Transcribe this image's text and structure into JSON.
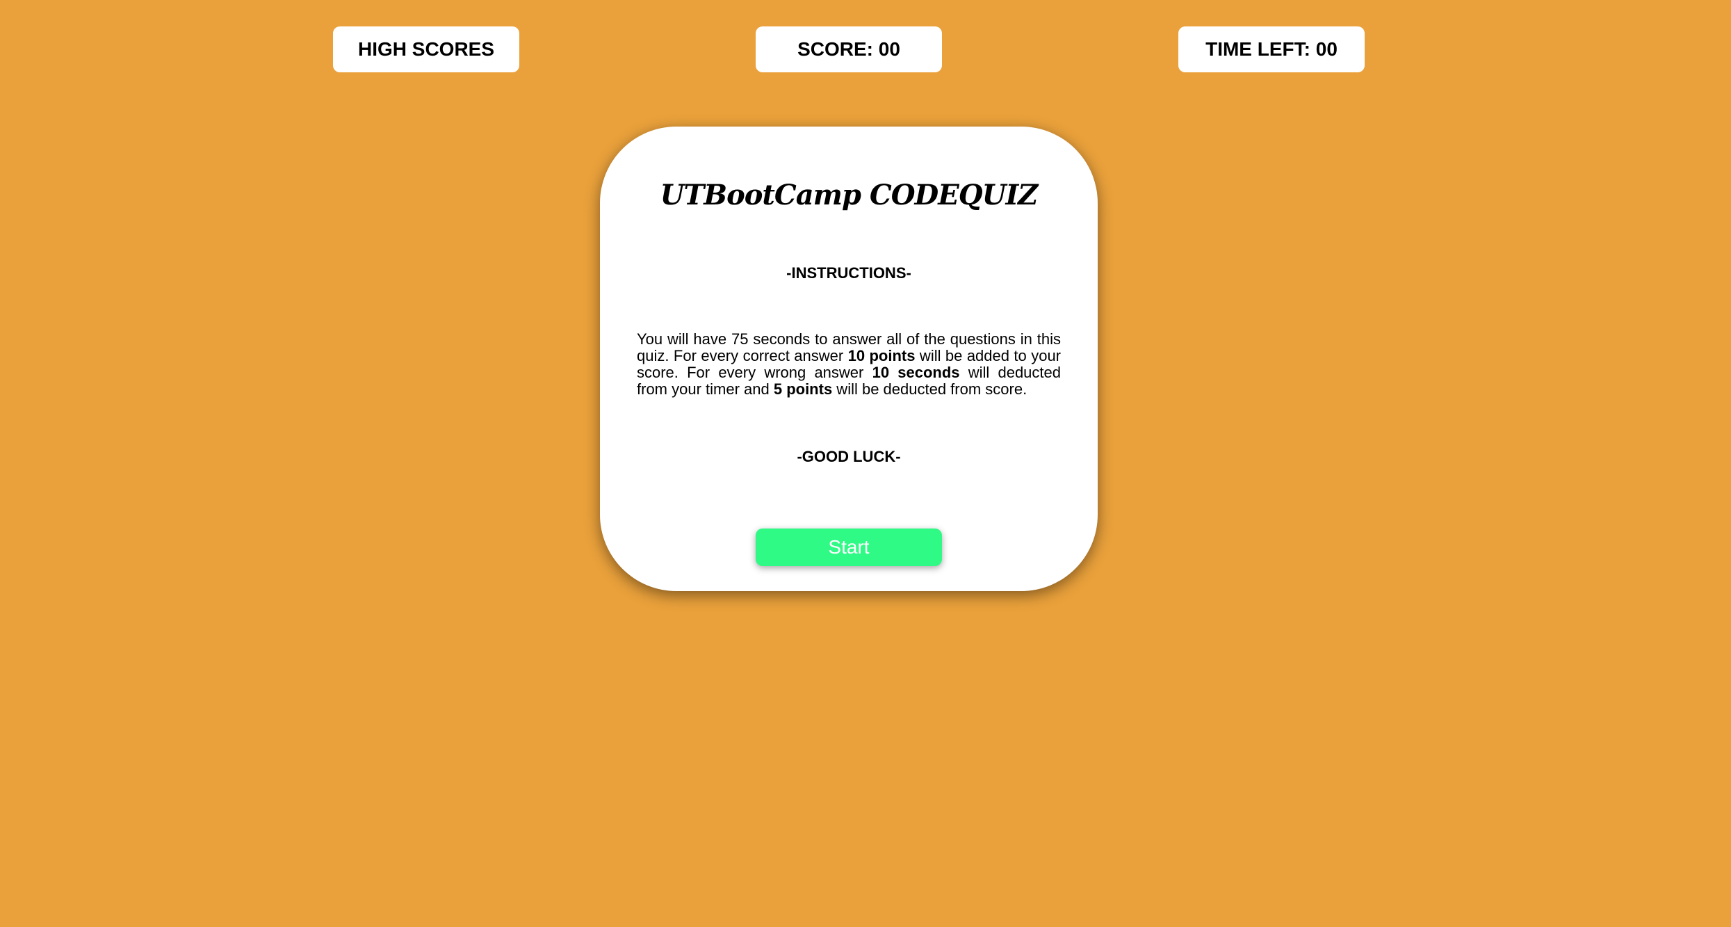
{
  "header": {
    "high_scores_label": "HIGH SCORES",
    "score_label": "SCORE: 00",
    "time_left_label": "TIME LEFT: 00"
  },
  "card": {
    "title": "UTBootCamp CODEQUIZ",
    "instructions_heading": "-INSTRUCTIONS-",
    "instructions": {
      "part1": "You will have 75 seconds to answer all of the questions in this quiz. For every correct answer ",
      "bold1": "10 points",
      "part2": " will be added to your score. For every wrong answer ",
      "bold2": "10 seconds",
      "part3": " will deducted from your timer and ",
      "bold3": "5 points",
      "part4": " will be deducted from score."
    },
    "good_luck": "-GOOD LUCK-",
    "start_label": "Start"
  },
  "colors": {
    "background": "#EAA13B",
    "start_button": "#2EFA85",
    "card": "#FFFFFF"
  }
}
